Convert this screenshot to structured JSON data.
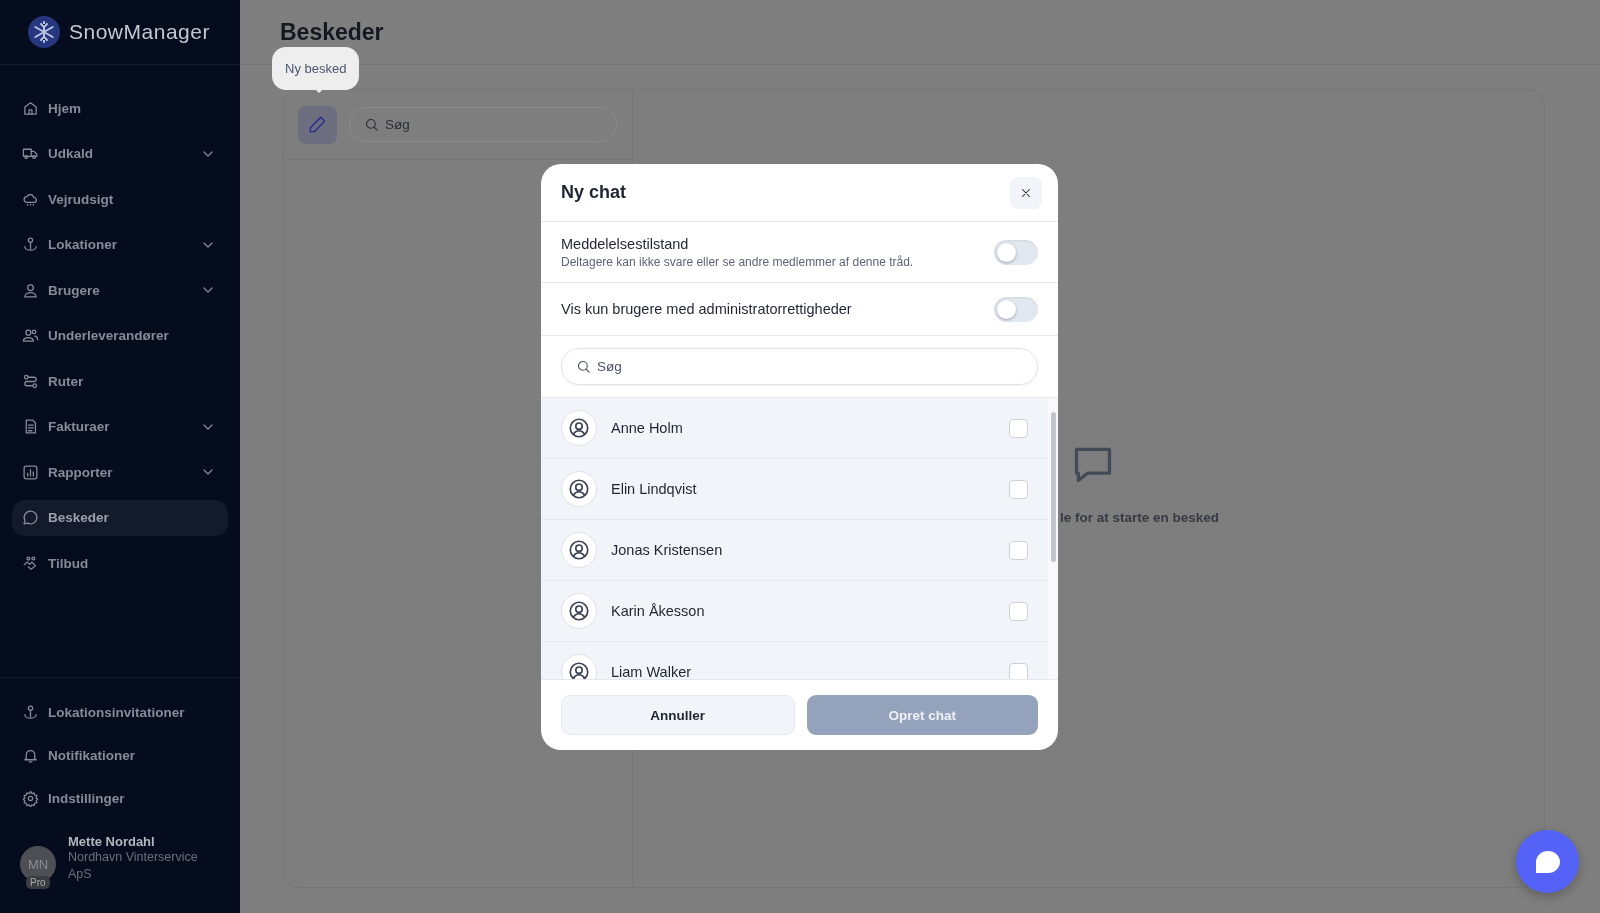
{
  "sidebar": {
    "logo": "SnowManager",
    "items": [
      {
        "label": "Hjem",
        "expandable": false,
        "selected": false
      },
      {
        "label": "Udkald",
        "expandable": true,
        "selected": false
      },
      {
        "label": "Vejrudsigt",
        "expandable": false,
        "selected": false
      },
      {
        "label": "Lokationer",
        "expandable": true,
        "selected": false
      },
      {
        "label": "Brugere",
        "expandable": true,
        "selected": false
      },
      {
        "label": "Underleverandører",
        "expandable": false,
        "selected": false
      },
      {
        "label": "Ruter",
        "expandable": false,
        "selected": false
      },
      {
        "label": "Fakturaer",
        "expandable": true,
        "selected": false
      },
      {
        "label": "Rapporter",
        "expandable": true,
        "selected": false
      },
      {
        "label": "Beskeder",
        "expandable": false,
        "selected": true
      },
      {
        "label": "Tilbud",
        "expandable": false,
        "selected": false
      }
    ],
    "footer_items": [
      {
        "label": "Lokationsinvitationer"
      },
      {
        "label": "Notifikationer"
      },
      {
        "label": "Indstillinger"
      }
    ],
    "user": {
      "initials": "MN",
      "badge": "Pro",
      "name": "Mette Nordahl",
      "company": "Nordhavn Vinterservice ApS"
    }
  },
  "main": {
    "title": "Beskeder",
    "tooltip": "Ny besked",
    "search": {
      "placeholder": "Søg"
    },
    "empty_state": "le for at starte en besked"
  },
  "modal": {
    "title": "Ny chat",
    "toggles": [
      {
        "label": "Meddelelsestilstand",
        "description": "Deltagere kan ikke svare eller se andre medlemmer af denne tråd.",
        "on": false
      },
      {
        "label": "Vis kun brugere med administratorrettigheder",
        "on": false
      }
    ],
    "search": {
      "placeholder": "Søg"
    },
    "users": [
      {
        "name": "Anne Holm",
        "checked": false
      },
      {
        "name": "Elin Lindqvist",
        "checked": false
      },
      {
        "name": "Jonas Kristensen",
        "checked": false
      },
      {
        "name": "Karin Åkesson",
        "checked": false
      },
      {
        "name": "Liam Walker",
        "checked": false
      }
    ],
    "cancel": {
      "label": "Annuller"
    },
    "create": {
      "label": "Opret chat",
      "disabled": true
    }
  }
}
